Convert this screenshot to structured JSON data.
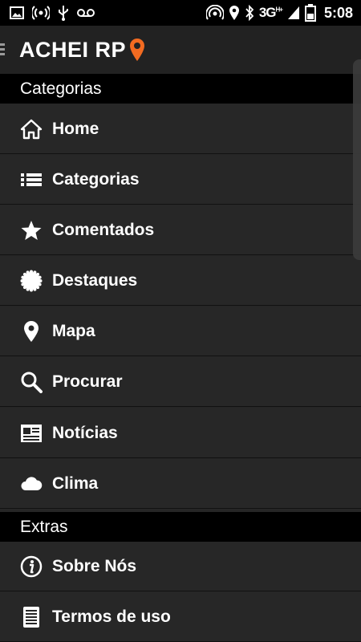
{
  "status_bar": {
    "network": "3G",
    "network_sup": "H+",
    "time": "5:08",
    "left_icons": [
      "image-icon",
      "wifi-hotspot-icon",
      "usb-icon",
      "voicemail-icon"
    ],
    "right_icons": [
      "nfc-icon",
      "location-icon",
      "bluetooth-icon",
      "signal-icon",
      "battery-icon"
    ]
  },
  "app": {
    "title": "ACHEI RP",
    "accent": "#f26b21"
  },
  "sections": [
    {
      "title": "Categorias",
      "items": [
        {
          "label": "Home",
          "icon": "home-icon"
        },
        {
          "label": "Categorias",
          "icon": "list-icon"
        },
        {
          "label": "Comentados",
          "icon": "star-icon"
        },
        {
          "label": "Destaques",
          "icon": "badge-icon"
        },
        {
          "label": "Mapa",
          "icon": "map-pin-icon"
        },
        {
          "label": "Procurar",
          "icon": "search-icon"
        },
        {
          "label": "Notícias",
          "icon": "newspaper-icon"
        },
        {
          "label": "Clima",
          "icon": "cloud-icon"
        }
      ]
    },
    {
      "title": "Extras",
      "items": [
        {
          "label": "Sobre Nós",
          "icon": "info-icon"
        },
        {
          "label": "Termos de uso",
          "icon": "document-icon"
        }
      ]
    }
  ]
}
